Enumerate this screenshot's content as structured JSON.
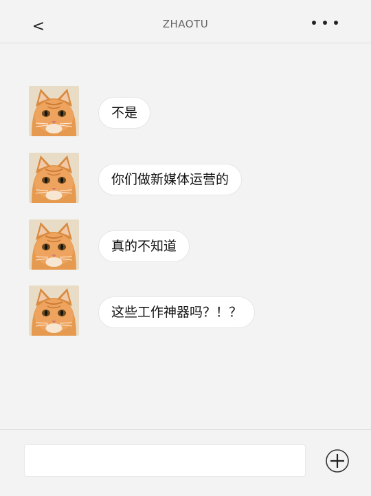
{
  "header": {
    "back_label": "<",
    "title": "ZHAOTU",
    "more_icon": "more-dots-icon"
  },
  "messages": [
    {
      "text": "不是"
    },
    {
      "text": "你们做新媒体运营的"
    },
    {
      "text": "真的不知道"
    },
    {
      "text": "这些工作神器吗？！？"
    }
  ],
  "footer": {
    "input_value": "",
    "plus_icon": "plus-circle-icon"
  },
  "colors": {
    "background": "#f3f3f3",
    "bubble": "#ffffff",
    "text": "#111111",
    "title": "#666666"
  }
}
